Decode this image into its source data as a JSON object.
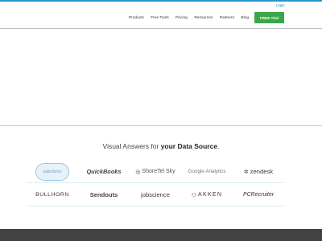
{
  "header": {
    "login_label": "Login",
    "nav": [
      "Products",
      "Free Tools",
      "Pricing",
      "Resources",
      "Partners",
      "Blog"
    ],
    "cta_label": "FREE Trial"
  },
  "integrations": {
    "headline_prefix": "Visual Answers for ",
    "headline_strong": "your Data Source",
    "headline_suffix": ".",
    "logos_row1": [
      {
        "name": "salesforce",
        "label": "salesforce"
      },
      {
        "name": "quickbooks",
        "label": "QuickBooks"
      },
      {
        "name": "shoretel-sky",
        "label": "ShoreTel Sky"
      },
      {
        "name": "google-analytics",
        "label": "Google Analytics"
      },
      {
        "name": "zendesk",
        "label": "zendesk"
      }
    ],
    "logos_row2": [
      {
        "name": "bullhorn",
        "label": "BULLHORN"
      },
      {
        "name": "sendouts",
        "label": "Sendouts"
      },
      {
        "name": "jobscience",
        "label": "jobscience"
      },
      {
        "name": "akken",
        "label": "AKKEN"
      },
      {
        "name": "pcrecruiter",
        "label": "PCRecruiter"
      }
    ]
  },
  "colors": {
    "accent": "#2a93c9",
    "cta": "#3aa64a",
    "footer": "#424242"
  }
}
